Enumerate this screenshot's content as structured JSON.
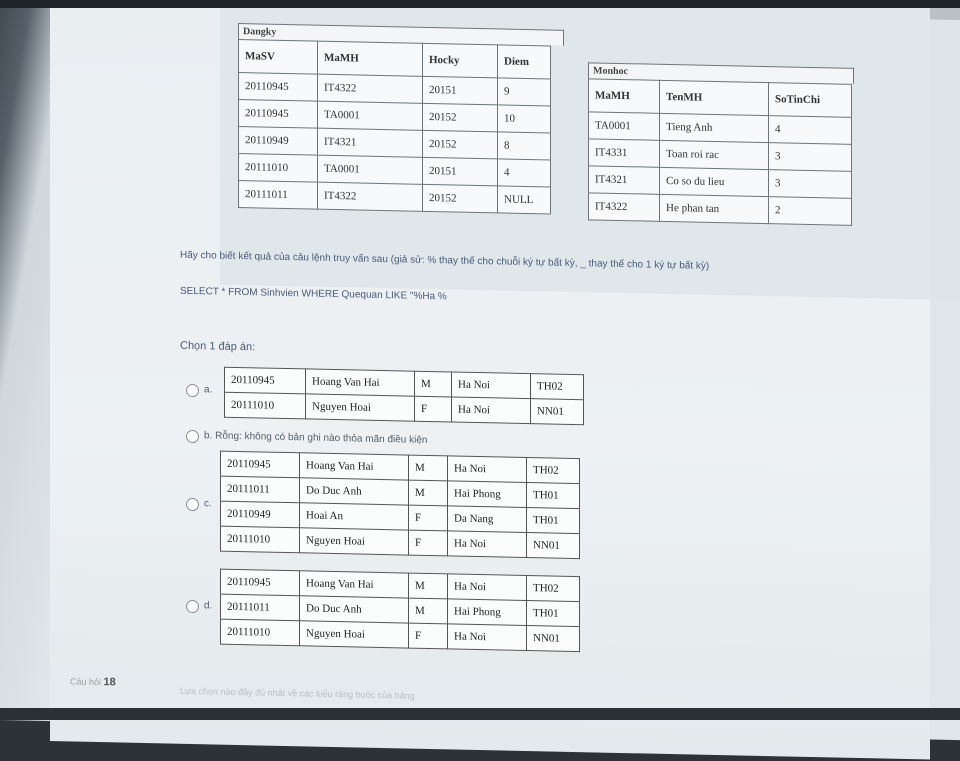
{
  "dangky": {
    "caption": "Dangky",
    "headers": [
      "MaSV",
      "MaMH",
      "Hocky",
      "Diem"
    ],
    "rows": [
      [
        "20110945",
        "IT4322",
        "20151",
        "9"
      ],
      [
        "20110945",
        "TA0001",
        "20152",
        "10"
      ],
      [
        "20110949",
        "IT4321",
        "20152",
        "8"
      ],
      [
        "20111010",
        "TA0001",
        "20151",
        "4"
      ],
      [
        "20111011",
        "IT4322",
        "20152",
        "NULL"
      ]
    ]
  },
  "monhoc": {
    "caption": "Monhoc",
    "headers": [
      "MaMH",
      "TenMH",
      "SoTinChi"
    ],
    "rows": [
      [
        "TA0001",
        "Tieng Anh",
        "4"
      ],
      [
        "IT4331",
        "Toan roi rac",
        "3"
      ],
      [
        "IT4321",
        "Co so du lieu",
        "3"
      ],
      [
        "IT4322",
        "He phan tan",
        "2"
      ]
    ]
  },
  "question": {
    "text": "Hãy cho biết kết quả của câu lệnh truy vấn sau (giả sử: % thay thế cho chuỗi ký tự bất kỳ, _ thay thế cho 1 ký tự bất kỳ)",
    "sql": "SELECT * FROM Sinhvien WHERE Quequan LIKE \"%Ha %"
  },
  "choose_label": "Chọn 1 đáp án:",
  "options": {
    "a": {
      "label": "a.",
      "rows": [
        [
          "20110945",
          "Hoang Van Hai",
          "M",
          "Ha Noi",
          "TH02"
        ],
        [
          "20111010",
          "Nguyen Hoai",
          "F",
          "Ha Noi",
          "NN01"
        ]
      ]
    },
    "b": {
      "label": "b. Rỗng: không có bản ghi nào thỏa mãn điều kiện"
    },
    "c": {
      "label": "c.",
      "rows": [
        [
          "20110945",
          "Hoang Van Hai",
          "M",
          "Ha Noi",
          "TH02"
        ],
        [
          "20111011",
          "Do Duc Anh",
          "M",
          "Hai Phong",
          "TH01"
        ],
        [
          "20110949",
          "Hoai An",
          "F",
          "Da Nang",
          "TH01"
        ],
        [
          "20111010",
          "Nguyen Hoai",
          "F",
          "Ha Noi",
          "NN01"
        ]
      ]
    },
    "d": {
      "label": "d.",
      "rows": [
        [
          "20110945",
          "Hoang Van Hai",
          "M",
          "Ha Noi",
          "TH02"
        ],
        [
          "20111011",
          "Do Duc Anh",
          "M",
          "Hai Phong",
          "TH01"
        ],
        [
          "20111010",
          "Nguyen Hoai",
          "F",
          "Ha Noi",
          "NN01"
        ]
      ]
    }
  },
  "footer": {
    "label": "Câu hỏi",
    "number": "18",
    "next_text": "Lựa chọn nào đầy đủ nhất về các kiểu ràng buộc của bảng"
  }
}
